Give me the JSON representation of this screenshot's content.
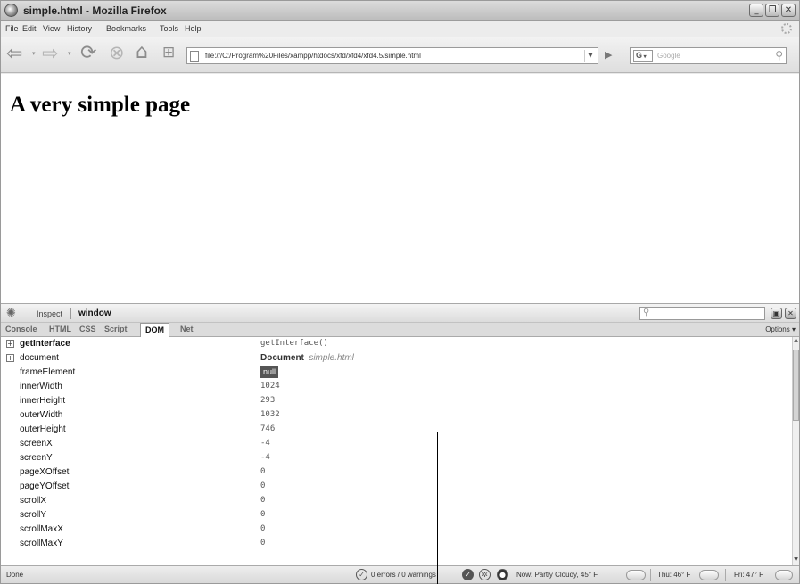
{
  "window": {
    "title": "simple.html - Mozilla Firefox",
    "buttons": {
      "minimize": "_",
      "maximize": "❐",
      "close": "✕"
    }
  },
  "menu": [
    "File",
    "Edit",
    "View",
    "History",
    "Bookmarks",
    "Tools",
    "Help"
  ],
  "navigation": {
    "url": "file:///C:/Program%20Files/xampp/htdocs/xfd/xfd4/xfd4.5/simple.html",
    "search_engine_label": "G",
    "search_placeholder": "Google"
  },
  "page": {
    "heading": "A very simple page"
  },
  "firebug": {
    "inspect_label": "Inspect",
    "context_label": "window",
    "tabs": [
      "Console",
      "HTML",
      "CSS",
      "Script",
      "DOM",
      "Net"
    ],
    "selected_tab": "DOM",
    "options_label": "Options ▾",
    "dom_rows": [
      {
        "name": "getInterface",
        "value": "getInterface()",
        "expandable": true
      },
      {
        "name": "document",
        "value_type": "Document",
        "value_name": "simple.html",
        "expandable": true
      },
      {
        "name": "frameElement",
        "value": "null"
      },
      {
        "name": "innerWidth",
        "value": "1024"
      },
      {
        "name": "innerHeight",
        "value": "293"
      },
      {
        "name": "outerWidth",
        "value": "1032"
      },
      {
        "name": "outerHeight",
        "value": "746"
      },
      {
        "name": "screenX",
        "value": "-4"
      },
      {
        "name": "screenY",
        "value": "-4"
      },
      {
        "name": "pageXOffset",
        "value": "0"
      },
      {
        "name": "pageYOffset",
        "value": "0"
      },
      {
        "name": "scrollX",
        "value": "0"
      },
      {
        "name": "scrollY",
        "value": "0"
      },
      {
        "name": "scrollMaxX",
        "value": "0"
      },
      {
        "name": "scrollMaxY",
        "value": "0"
      }
    ]
  },
  "status": {
    "text": "Done",
    "errors": "0 errors / 0 warnings",
    "weather_now": "Now: Partly Cloudy, 45° F",
    "weather_thu": "Thu: 46° F",
    "weather_fri": "Fri: 47° F"
  }
}
